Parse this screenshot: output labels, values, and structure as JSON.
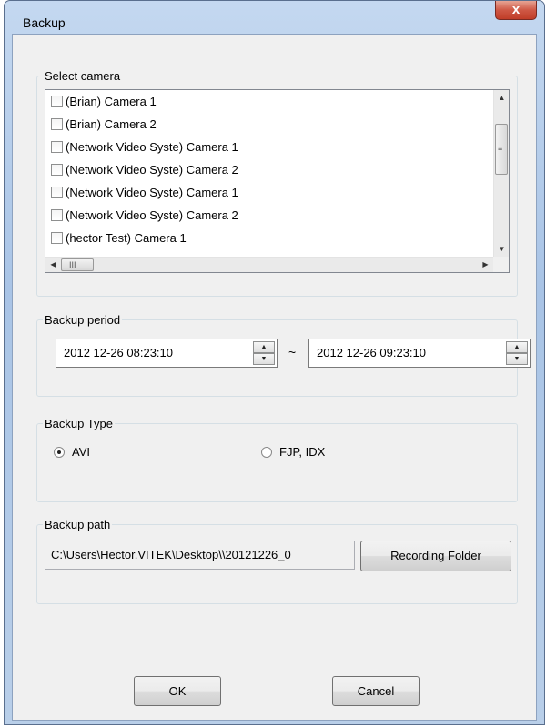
{
  "window": {
    "title": "Backup",
    "close_glyph": "x"
  },
  "camera_group": {
    "label": "Select camera",
    "items": [
      "(Brian) Camera 1",
      "(Brian) Camera 2",
      "(Network Video Syste) Camera 1",
      "(Network Video Syste) Camera 2",
      "(Network Video Syste) Camera 1",
      "(Network Video Syste) Camera 2",
      "(hector Test) Camera 1"
    ],
    "scroll_up_icon": "▲",
    "scroll_down_icon": "▼",
    "scroll_left_icon": "◀",
    "scroll_right_icon": "▶",
    "v_grip": "≡",
    "h_grip": "III"
  },
  "period_group": {
    "label": "Backup period",
    "start": "2012 12-26 08:23:10",
    "end": "2012 12-26 09:23:10",
    "separator": "~",
    "spin_up": "▲",
    "spin_down": "▼"
  },
  "type_group": {
    "label": "Backup Type",
    "options": [
      {
        "label": "AVI",
        "selected": true
      },
      {
        "label": "FJP, IDX",
        "selected": false
      }
    ]
  },
  "path_group": {
    "label": "Backup path",
    "path": "C:\\Users\\Hector.VITEK\\Desktop\\\\20121226_0",
    "folder_button": "Recording Folder"
  },
  "buttons": {
    "ok": "OK",
    "cancel": "Cancel"
  },
  "colors": {
    "frame": "#b9cfe9",
    "close": "#c8432f",
    "client": "#f0f0f0"
  }
}
